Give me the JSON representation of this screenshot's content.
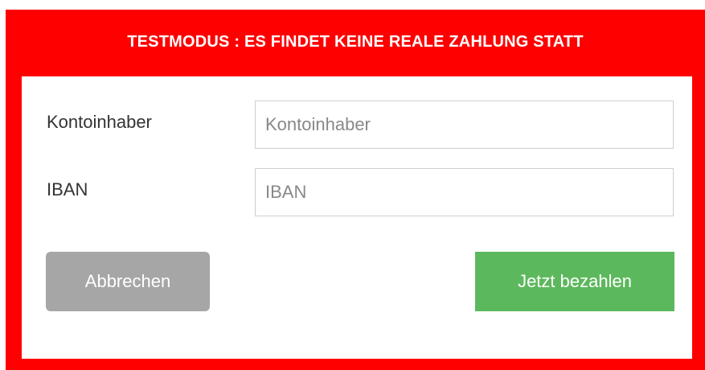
{
  "banner": {
    "text": "TESTMODUS : ES FINDET KEINE REALE ZAHLUNG STATT",
    "color": "#ff0000"
  },
  "form": {
    "account_holder": {
      "label": "Kontoinhaber",
      "placeholder": "Kontoinhaber",
      "value": ""
    },
    "iban": {
      "label": "IBAN",
      "placeholder": "IBAN",
      "value": ""
    }
  },
  "buttons": {
    "cancel_label": "Abbrechen",
    "cancel_color": "#a6a6a6",
    "pay_label": "Jetzt bezahlen",
    "pay_color": "#5cb85c"
  }
}
